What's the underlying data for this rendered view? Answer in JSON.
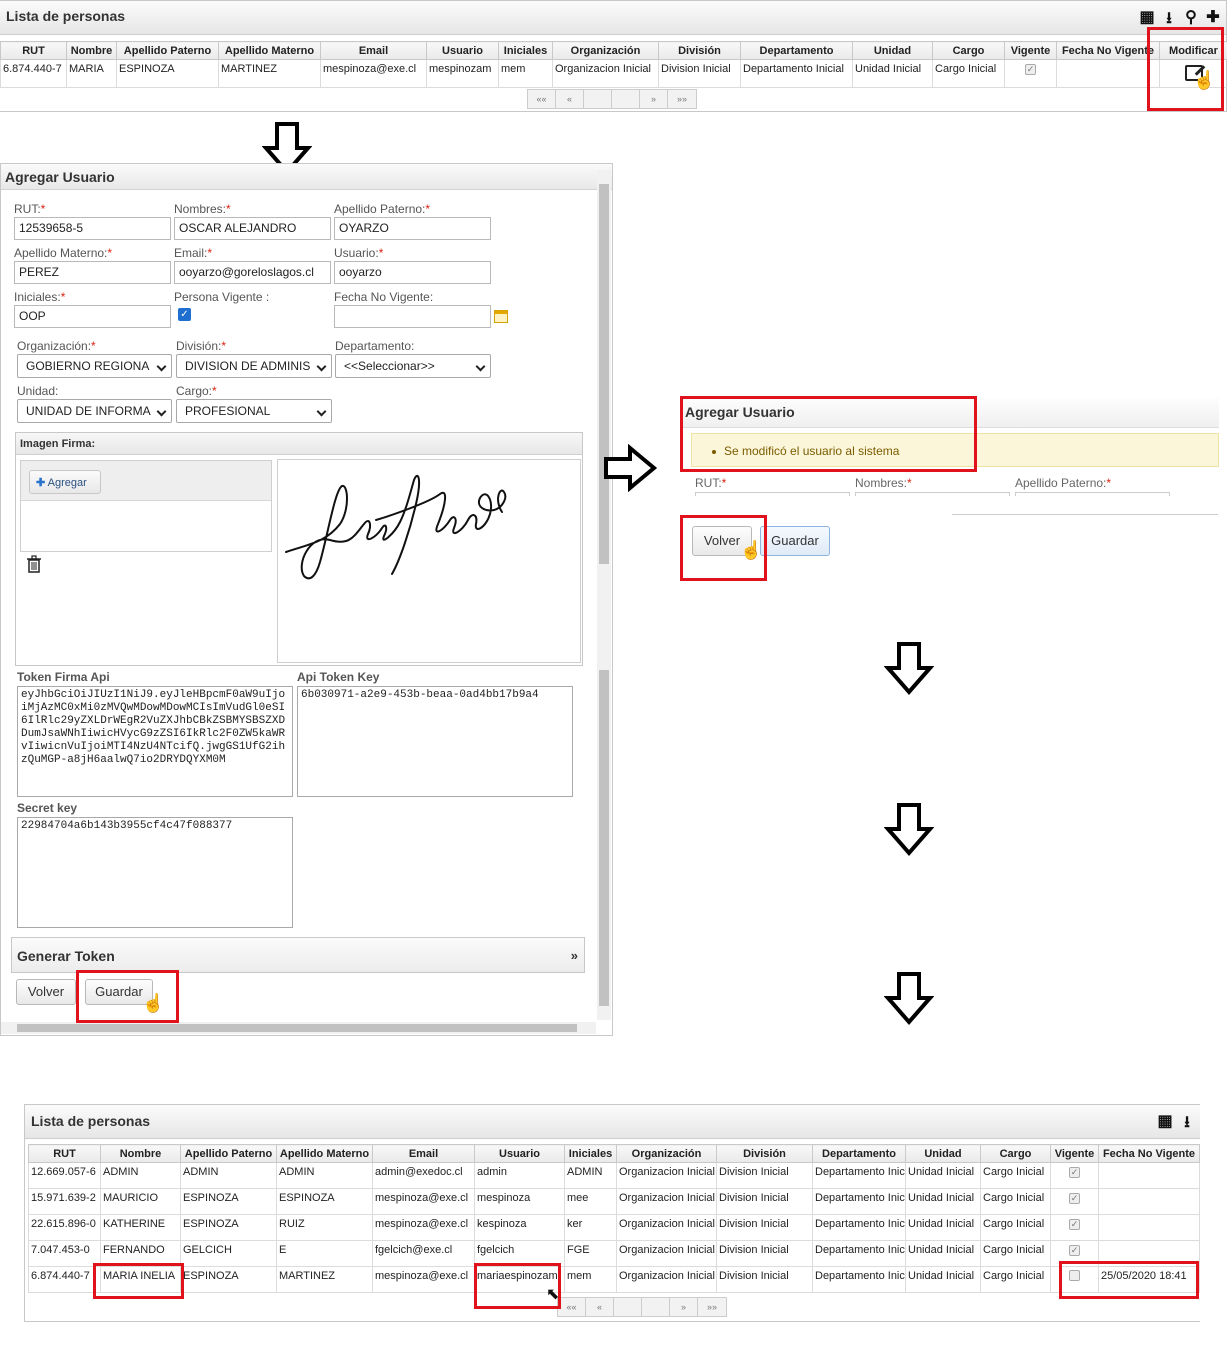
{
  "grid1": {
    "title": "Lista de personas",
    "columns": [
      "RUT",
      "Nombre",
      "Apellido Paterno",
      "Apellido Materno",
      "Email",
      "Usuario",
      "Iniciales",
      "Organización",
      "División",
      "Departamento",
      "Unidad",
      "Cargo",
      "Vigente",
      "Fecha No Vigente",
      "Modificar"
    ],
    "rows": [
      [
        "6.874.440-7",
        "MARIA",
        "ESPINOZA",
        "MARTINEZ",
        "mespinoza@exe.cl",
        "mespinozam",
        "mem",
        "Organizacion Inicial",
        "Division Inicial",
        "Departamento Inicial",
        "Unidad Inicial",
        "Cargo Inicial",
        "✓",
        ""
      ]
    ],
    "pager": [
      "««",
      "«",
      "",
      "",
      "»",
      "»»"
    ]
  },
  "form": {
    "title": "Agregar Usuario",
    "rut_label": "RUT:",
    "rut_value": "12539658-5",
    "nombres_label": "Nombres:",
    "nombres_value": "OSCAR ALEJANDRO",
    "ap_paterno_label": "Apellido Paterno:",
    "ap_paterno_value": "OYARZO",
    "ap_materno_label": "Apellido Materno:",
    "ap_materno_value": "PEREZ",
    "email_label": "Email:",
    "email_value": "ooyarzo@goreloslagos.cl",
    "usuario_label": "Usuario:",
    "usuario_value": "ooyarzo",
    "iniciales_label": "Iniciales:",
    "iniciales_value": "OOP",
    "vigente_label": "Persona Vigente :",
    "fecha_label": "Fecha No Vigente:",
    "fecha_value": "",
    "org_label": "Organización:",
    "org_value": "GOBIERNO REGIONA",
    "div_label": "División:",
    "div_value": "DIVISION DE ADMINIS",
    "depto_label": "Departamento:",
    "depto_value": "<<Seleccionar>>",
    "unidad_label": "Unidad:",
    "unidad_value": "UNIDAD DE INFORMA",
    "cargo_label": "Cargo:",
    "cargo_value": "PROFESIONAL",
    "firma_label": "Imagen Firma:",
    "agregar_label": "Agregar",
    "token_label": "Token Firma Api",
    "token_value": "eyJhbGciOiJIUzI1NiJ9.eyJleHBpcmF0aW9uIjoiMjAzMC0xMi0zMVQwMDowMDowMCIsImVudGl0eSI6IlRlc29yZXLDrWEgR2VuZXJhbCBkZSBMYSBSZXDDumJsaWNhIiwicHVycG9zZSI6IkRlc2F0ZW5kaWRvIiwicnVuIjoiMTI4NzU4NTcifQ.jwgGS1UfG2ihzQuMGP-a8jH6aalwQ7io2DRYDQYXM0M",
    "apikey_label": "Api Token Key",
    "apikey_value": "6b030971-a2e9-453b-beaa-0ad4bb17b9a4",
    "secret_label": "Secret key",
    "secret_value": "22984704a6b143b3955cf4c47f088377",
    "generar_label": "Generar Token",
    "generar_chevron": "»",
    "volver_label": "Volver",
    "guardar_label": "Guardar"
  },
  "result": {
    "title": "Agregar Usuario",
    "message": "Se modificó el usuario al sistema",
    "rut_label": "RUT:",
    "nombres_label": "Nombres:",
    "ap_paterno_label": "Apellido Paterno:",
    "volver_label": "Volver",
    "guardar_label": "Guardar"
  },
  "grid2": {
    "title": "Lista de personas",
    "columns": [
      "RUT",
      "Nombre",
      "Apellido Paterno",
      "Apellido Materno",
      "Email",
      "Usuario",
      "Iniciales",
      "Organización",
      "División",
      "Departamento",
      "Unidad",
      "Cargo",
      "Vigente",
      "Fecha No Vigente"
    ],
    "rows": [
      [
        "12.669.057-6",
        "ADMIN",
        "ADMIN",
        "ADMIN",
        "admin@exedoc.cl",
        "admin",
        "ADMIN",
        "Organizacion Inicial",
        "Division Inicial",
        "Departamento Inicial",
        "Unidad Inicial",
        "Cargo Inicial",
        "✓",
        ""
      ],
      [
        "15.971.639-2",
        "MAURICIO",
        "ESPINOZA",
        "ESPINOZA",
        "mespinoza@exe.cl",
        "mespinoza",
        "mee",
        "Organizacion Inicial",
        "Division Inicial",
        "Departamento Inicial",
        "Unidad Inicial",
        "Cargo Inicial",
        "✓",
        ""
      ],
      [
        "22.615.896-0",
        "KATHERINE",
        "ESPINOZA",
        "RUIZ",
        "mespinoza@exe.cl",
        "kespinoza",
        "ker",
        "Organizacion Inicial",
        "Division Inicial",
        "Departamento Inicial",
        "Unidad Inicial",
        "Cargo Inicial",
        "✓",
        ""
      ],
      [
        "7.047.453-0",
        "FERNANDO",
        "GELCICH",
        "E",
        "fgelcich@exe.cl",
        "fgelcich",
        "FGE",
        "Organizacion Inicial",
        "Division Inicial",
        "Departamento Inicial",
        "Unidad Inicial",
        "Cargo Inicial",
        "✓",
        ""
      ],
      [
        "6.874.440-7",
        "MARIA INELIA",
        "ESPINOZA",
        "MARTINEZ",
        "mespinoza@exe.cl",
        "mariaespinozam",
        "mem",
        "Organizacion Inicial",
        "Division Inicial",
        "Departamento Inicial",
        "Unidad Inicial",
        "Cargo Inicial",
        "",
        "25/05/2020 18:41"
      ]
    ],
    "pager": [
      "««",
      "«",
      "",
      "",
      "»",
      "»»"
    ]
  },
  "icons": {
    "grid": "grid-icon",
    "download": "download-icon",
    "search": "search-icon",
    "add": "plus-icon",
    "edit": "edit-icon",
    "cursor": "hand-cursor-icon",
    "trash": "trash-icon",
    "arrow": "arrow-icon"
  },
  "colors": {
    "highlight": "#e0121c",
    "success_bg": "#fbf6d9",
    "success_text": "#7a5c00",
    "checkbox": "#1f6fd1"
  }
}
